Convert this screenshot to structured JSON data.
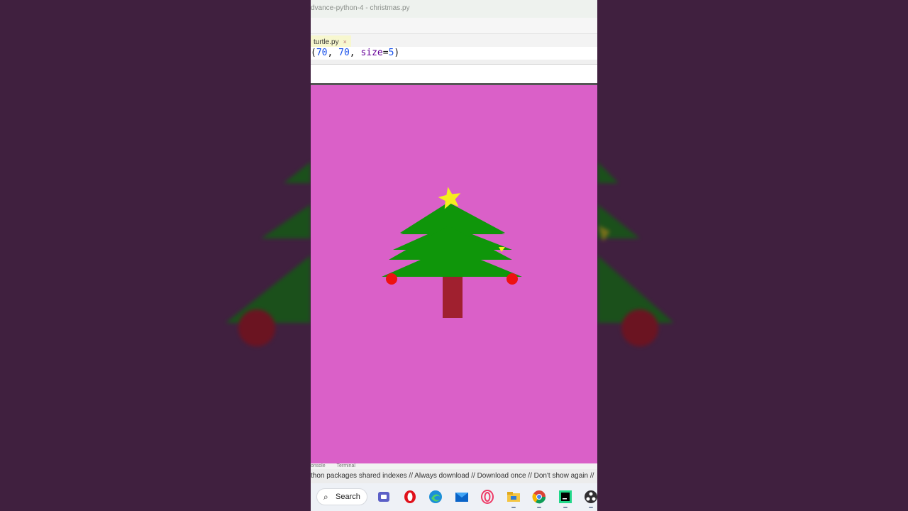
{
  "window": {
    "title": "dvance-python-4 - christmas.py"
  },
  "editor": {
    "tab_label": "turtle.py",
    "tab_close": "×",
    "code_line": {
      "p1": "(",
      "n1": "70",
      "p2": ", ",
      "n2": "70",
      "p3": ", ",
      "kw": "size",
      "p4": "=",
      "n3": "5",
      "p5": ")"
    }
  },
  "bottom_panel": {
    "tabs": [
      "onsole",
      "Terminal"
    ]
  },
  "notification": {
    "text": "thon packages shared indexes // Always download // Download once // Don't show again //"
  },
  "taskbar": {
    "search_label": "Search",
    "icons": [
      "search-icon",
      "teams-icon",
      "opera-icon",
      "edge-icon",
      "mail-icon",
      "opera-gx-icon",
      "file-explorer-icon",
      "chrome-icon",
      "pycharm-icon",
      "obs-icon"
    ]
  },
  "turtle_canvas": {
    "background": "#da60c8",
    "tree_color": "#0f960a",
    "trunk_color": "#a0202f",
    "star_color": "#f5ee1f",
    "ornament_color": "#ee1111"
  },
  "colors": {
    "side_background": "#40203f"
  }
}
